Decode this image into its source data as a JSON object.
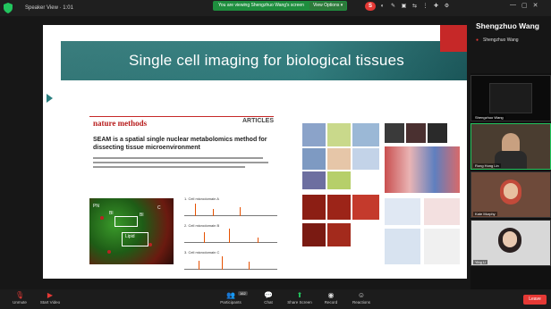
{
  "topbar": {
    "meeting_info": "Speaker View  ·  1:01",
    "share_banner": "You are viewing Shengzhuo Wang's screen",
    "view_options": "View Options ▾",
    "tray": [
      "S",
      "◐",
      "✎",
      "▣",
      "⇆",
      "⋮",
      "✚",
      "⚙"
    ]
  },
  "slide": {
    "title": "Single cell imaging for biological tissues",
    "paper": {
      "journal": "nature methods",
      "section": "ARTICLES",
      "title": "SEAM is a spatial single nuclear metabolomics method for dissecting tissue microenvironment"
    },
    "figure_labels": [
      "PN",
      "Bl",
      "C",
      "Bl",
      "Lipid"
    ],
    "spectra_labels": [
      "1. Cell microdomain A",
      "2. Cell microdomain B",
      "3. Cell microdomain C"
    ]
  },
  "panel": {
    "speaker_name": "Shengzhuo Wang",
    "speaker_label": "Shengzhuo Wang",
    "participants": [
      {
        "name": "Shengzhuo Wang"
      },
      {
        "name": "Rong Hong Lin"
      },
      {
        "name": "Kate Murphy"
      },
      {
        "name": "Ying Li"
      }
    ]
  },
  "controls": [
    {
      "label": "Unmute",
      "icon": "microphone-muted-icon"
    },
    {
      "label": "Start Video",
      "icon": "video-off-icon"
    },
    {
      "label": "Participants",
      "icon": "participants-icon",
      "count": "162"
    },
    {
      "label": "Chat",
      "icon": "chat-icon"
    },
    {
      "label": "Share Screen",
      "icon": "share-screen-icon"
    },
    {
      "label": "Record",
      "icon": "record-icon"
    },
    {
      "label": "Reactions",
      "icon": "reactions-icon"
    }
  ],
  "end_label": "Leave",
  "colors": {
    "accent_green": "#22c55e",
    "end_red": "#e53935",
    "title_band": "#2b7f80"
  }
}
